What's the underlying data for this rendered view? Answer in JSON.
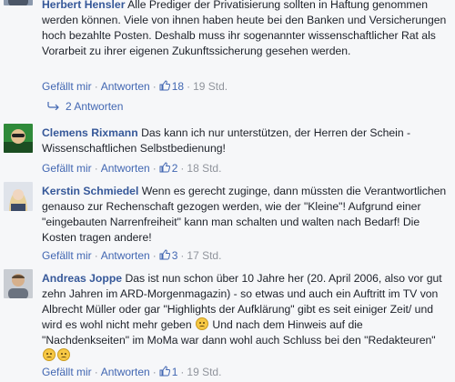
{
  "actions": {
    "like_label": "Gefällt mir",
    "reply_label": "Antworten",
    "separator": "·"
  },
  "comments": [
    {
      "author": "Herbert Hensler",
      "text": "Alle Prediger der Privatisierung sollten in Haftung genommen werden können. Viele von ihnen haben heute bei den Banken und Versicherungen hoch bezahlte Posten. Deshalb muss ihr sogenannter wissenschaftlicher Rat als Vorarbeit zu ihrer eigenen Zukunftssicherung gesehen werden.",
      "likes": "18",
      "time": "19 Std."
    },
    {
      "author": "Clemens Rixmann",
      "text": "Das kann ich nur unterstützen, der Herren der Schein -Wissenschaftlichen Selbstbedienung!",
      "likes": "2",
      "time": "18 Std."
    },
    {
      "author": "Kerstin Schmiedel",
      "text": "Wenn es gerecht zuginge, dann müssten die Verantwortlichen genauso zur Rechenschaft gezogen werden, wie der \"Kleine\"! Aufgrund einer \"eingebauten Narrenfreiheit\" kann man schalten und walten nach Bedarf! Die Kosten tragen andere!",
      "likes": "3",
      "time": "17 Std."
    },
    {
      "author": "Andreas Joppe",
      "text": "Das ist nun schon über 10 Jahre her (20. April 2006, also vor gut zehn Jahren im ARD-Morgenmagazin) - so etwas und auch ein Auftritt im TV von Albrecht Müller oder gar \"Highlights der Aufklärung\" gibt es seit einiger Zeit/ und wird es wohl nicht mehr geben",
      "text_2": "Und nach dem Hinweis auf die \"Nachdenkseiten\" im MoMa war dann wohl auch Schluss bei den \"Redakteuren\"",
      "likes": "1",
      "time": "19 Std."
    }
  ],
  "replies_label": "2 Antworten",
  "colors": {
    "author": "#365899",
    "link": "#4267b2",
    "meta": "#90949c",
    "background": "#f6f7f9"
  }
}
